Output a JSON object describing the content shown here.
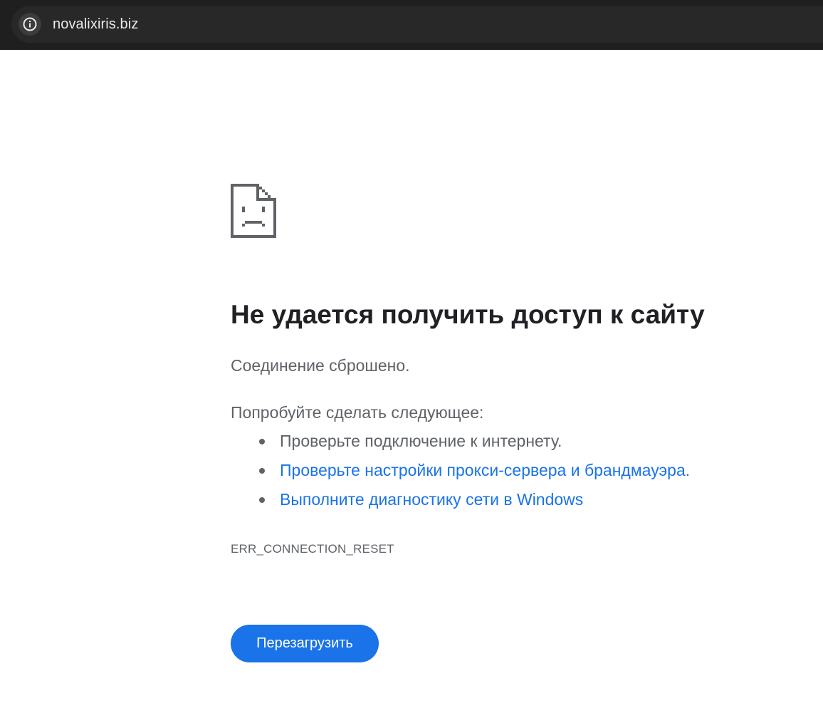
{
  "browser": {
    "url": "novalixiris.biz",
    "site_info_icon": "info-icon",
    "toolbar_color": "#1f1f1f",
    "omnibox_color": "#282828"
  },
  "error_page": {
    "icon": "sad-document-icon",
    "heading": "Не удается получить доступ к сайту",
    "summary": "Соединение сброшено.",
    "suggestions_title": "Попробуйте сделать следующее:",
    "suggestions": [
      {
        "text": "Проверьте подключение к интернету.",
        "is_link": false
      },
      {
        "text": "Проверьте настройки прокси-сервера и брандмауэра.",
        "is_link": true
      },
      {
        "text": "Выполните диагностику сети в Windows",
        "is_link": true
      }
    ],
    "error_code": "ERR_CONNECTION_RESET",
    "reload_label": "Перезагрузить",
    "colors": {
      "heading": "#202124",
      "text": "#5f6368",
      "link": "#1a73e8",
      "button": "#1a73e8"
    }
  }
}
